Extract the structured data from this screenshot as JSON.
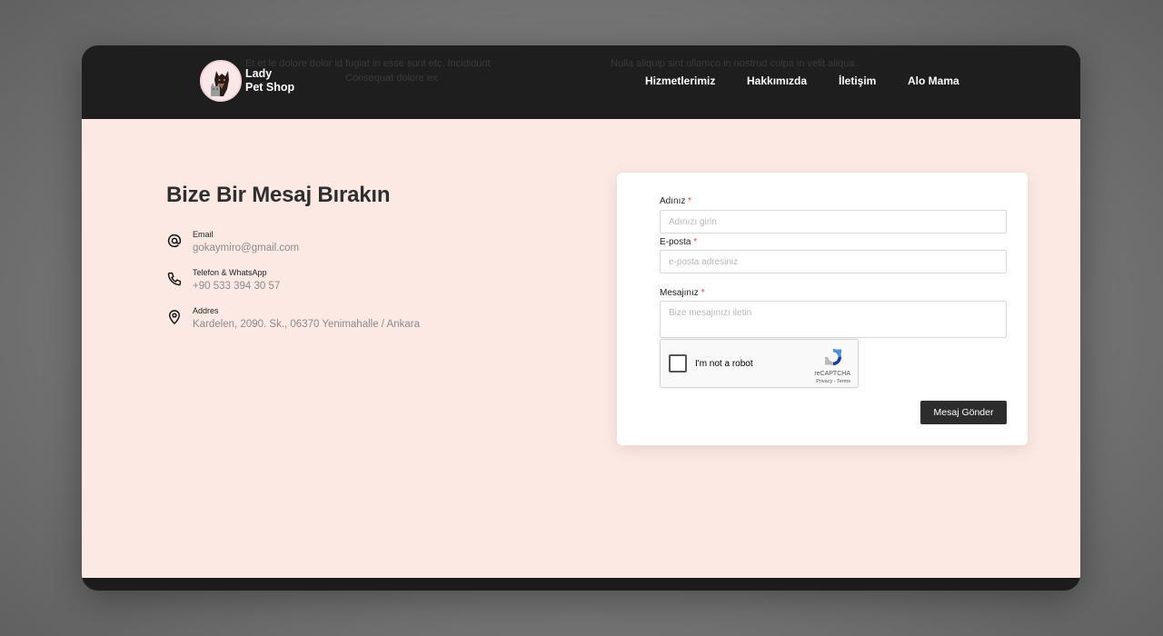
{
  "brand": {
    "line1": "Lady",
    "line2": "Pet Shop"
  },
  "nav": {
    "items": [
      "Hizmetlerimiz",
      "Hakkımızda",
      "İletişim",
      "Alo Mama"
    ]
  },
  "contact": {
    "title": "Bize Bir Mesaj Bırakın",
    "items": [
      {
        "icon": "at-icon",
        "label": "Email",
        "value": "gokaymiro@gmail.com"
      },
      {
        "icon": "phone-icon",
        "label": "Telefon & WhatsApp",
        "value": "+90 533 394 30 57"
      },
      {
        "icon": "location-pin-icon",
        "label": "Addres",
        "value": "Kardelen, 2090. Sk., 06370 Yenimahalle / Ankara"
      }
    ]
  },
  "form": {
    "name": {
      "label": "Adınız",
      "required_mark": "*",
      "placeholder": "Adınızı girin",
      "value": ""
    },
    "email": {
      "label": "E-posta",
      "required_mark": "*",
      "placeholder": "e-posta adresiniz",
      "value": ""
    },
    "message": {
      "label": "Mesajınız",
      "required_mark": "*",
      "placeholder": "Bize mesajınızı iletin",
      "value": ""
    },
    "captcha": {
      "label": "I'm not a robot",
      "brand": "reCAPTCHA",
      "terms": "Privacy - Terms"
    },
    "submit_label": "Mesaj Gönder"
  },
  "colors": {
    "navbar_bg": "#1e1e1e",
    "content_bg": "#fde9e4",
    "button_bg": "#2d2d2d",
    "required": "#e34b4b"
  }
}
